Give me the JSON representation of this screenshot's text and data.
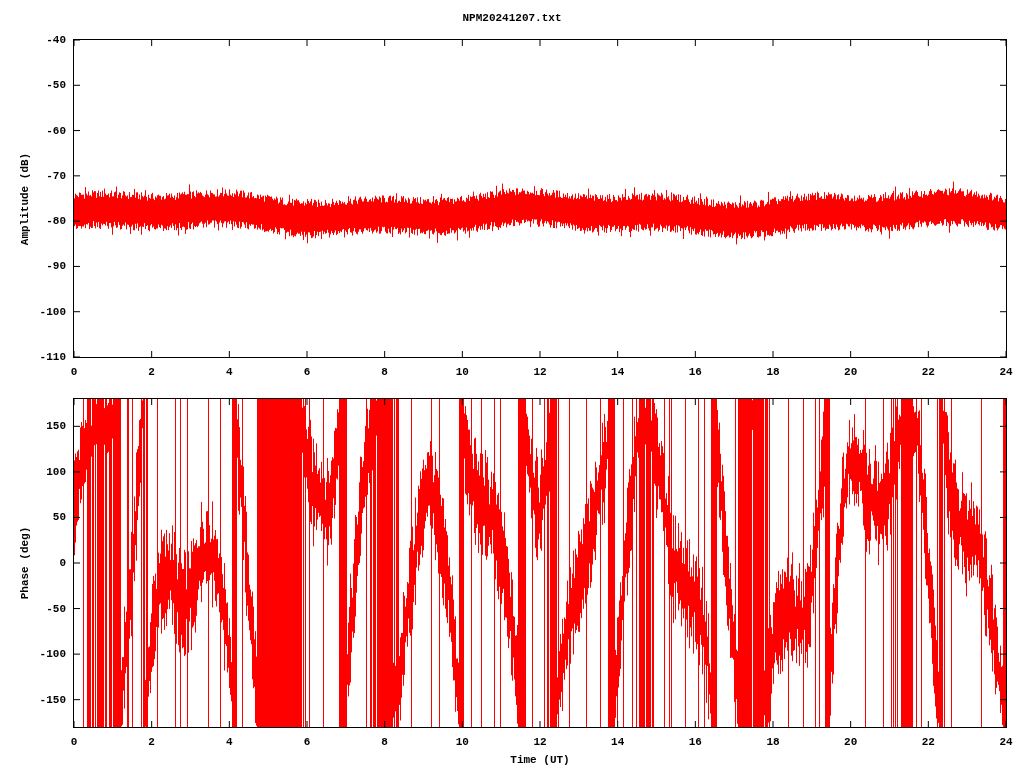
{
  "title": "NPM20241207.txt",
  "panels": [
    {
      "kind": "amplitude",
      "ylabel": "Amplitude (dB)",
      "yticks": [
        "-40",
        "-50",
        "-60",
        "-70",
        "-80",
        "-90",
        "-100",
        "-110"
      ],
      "xticks": [
        "0",
        "2",
        "4",
        "6",
        "8",
        "10",
        "12",
        "14",
        "16",
        "18",
        "20",
        "22",
        "24"
      ]
    },
    {
      "kind": "phase",
      "ylabel": "Phase (deg)",
      "yticks": [
        "150",
        "100",
        "50",
        "0",
        "-50",
        "-100",
        "-150"
      ],
      "xticks": [
        "0",
        "2",
        "4",
        "6",
        "8",
        "10",
        "12",
        "14",
        "16",
        "18",
        "20",
        "22",
        "24"
      ],
      "xlabel": "Time (UT)"
    }
  ]
}
